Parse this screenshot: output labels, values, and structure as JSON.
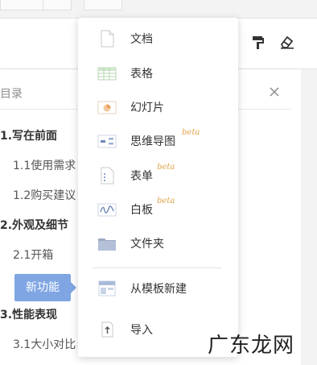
{
  "toc": {
    "title": "目录",
    "items": [
      {
        "label": "1.写在前面",
        "level": 1
      },
      {
        "label": "1.1使用需求",
        "level": 2
      },
      {
        "label": "1.2购买建议",
        "level": 2
      },
      {
        "label": "2.外观及细节",
        "level": 1
      },
      {
        "label": "2.1开箱",
        "level": 2
      },
      {
        "label": "3.性能表现",
        "level": 1
      },
      {
        "label": "3.1大小对比",
        "level": 2
      }
    ]
  },
  "tooltip": {
    "label": "新功能"
  },
  "menu": {
    "items": [
      {
        "label": "文档",
        "icon": "doc-icon"
      },
      {
        "label": "表格",
        "icon": "sheet-icon"
      },
      {
        "label": "幻灯片",
        "icon": "slides-icon"
      },
      {
        "label": "思维导图",
        "icon": "mindmap-icon",
        "badge": "beta"
      },
      {
        "label": "表单",
        "icon": "form-icon",
        "badge": "beta"
      },
      {
        "label": "白板",
        "icon": "whiteboard-icon",
        "badge": "beta"
      },
      {
        "label": "文件夹",
        "icon": "folder-icon"
      },
      {
        "label": "从模板新建",
        "icon": "template-icon"
      },
      {
        "label": "导入",
        "icon": "import-icon"
      }
    ]
  },
  "toolbar": {
    "icons": [
      "format-painter-icon",
      "eraser-icon"
    ]
  },
  "watermark": {
    "text": "广东龙网"
  },
  "colors": {
    "beta": "#e0a44a",
    "tooltip": "#7fa5e3"
  }
}
